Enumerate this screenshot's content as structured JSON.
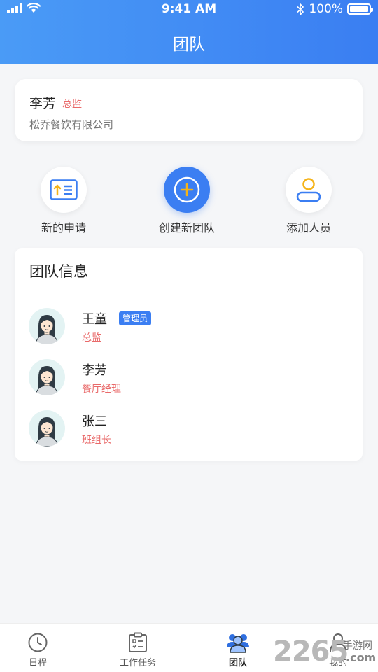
{
  "status_bar": {
    "time": "9:41 AM",
    "battery": "100%"
  },
  "header": {
    "title": "团队"
  },
  "profile": {
    "name": "李芳",
    "role": "总监",
    "company": "松乔餐饮有限公司"
  },
  "actions": [
    {
      "label": "新的申请",
      "icon": "application-icon"
    },
    {
      "label": "创建新团队",
      "icon": "plus-circle-icon"
    },
    {
      "label": "添加人员",
      "icon": "add-person-icon"
    }
  ],
  "team": {
    "title": "团队信息",
    "members": [
      {
        "name": "王童",
        "role": "总监",
        "badge": "管理员"
      },
      {
        "name": "李芳",
        "role": "餐厅经理"
      },
      {
        "name": "张三",
        "role": "班组长"
      }
    ]
  },
  "tabs": [
    {
      "label": "日程",
      "icon": "clock-icon"
    },
    {
      "label": "工作任务",
      "icon": "clipboard-icon"
    },
    {
      "label": "团队",
      "icon": "team-icon",
      "active": true
    },
    {
      "label": "我的",
      "icon": "user-icon"
    }
  ],
  "watermark": {
    "number": "2265",
    "text": "手游网",
    "suffix": ".com"
  },
  "colors": {
    "primary": "#3b7ef2",
    "role_text": "#e96a6a",
    "accent_yellow": "#f5b318"
  }
}
